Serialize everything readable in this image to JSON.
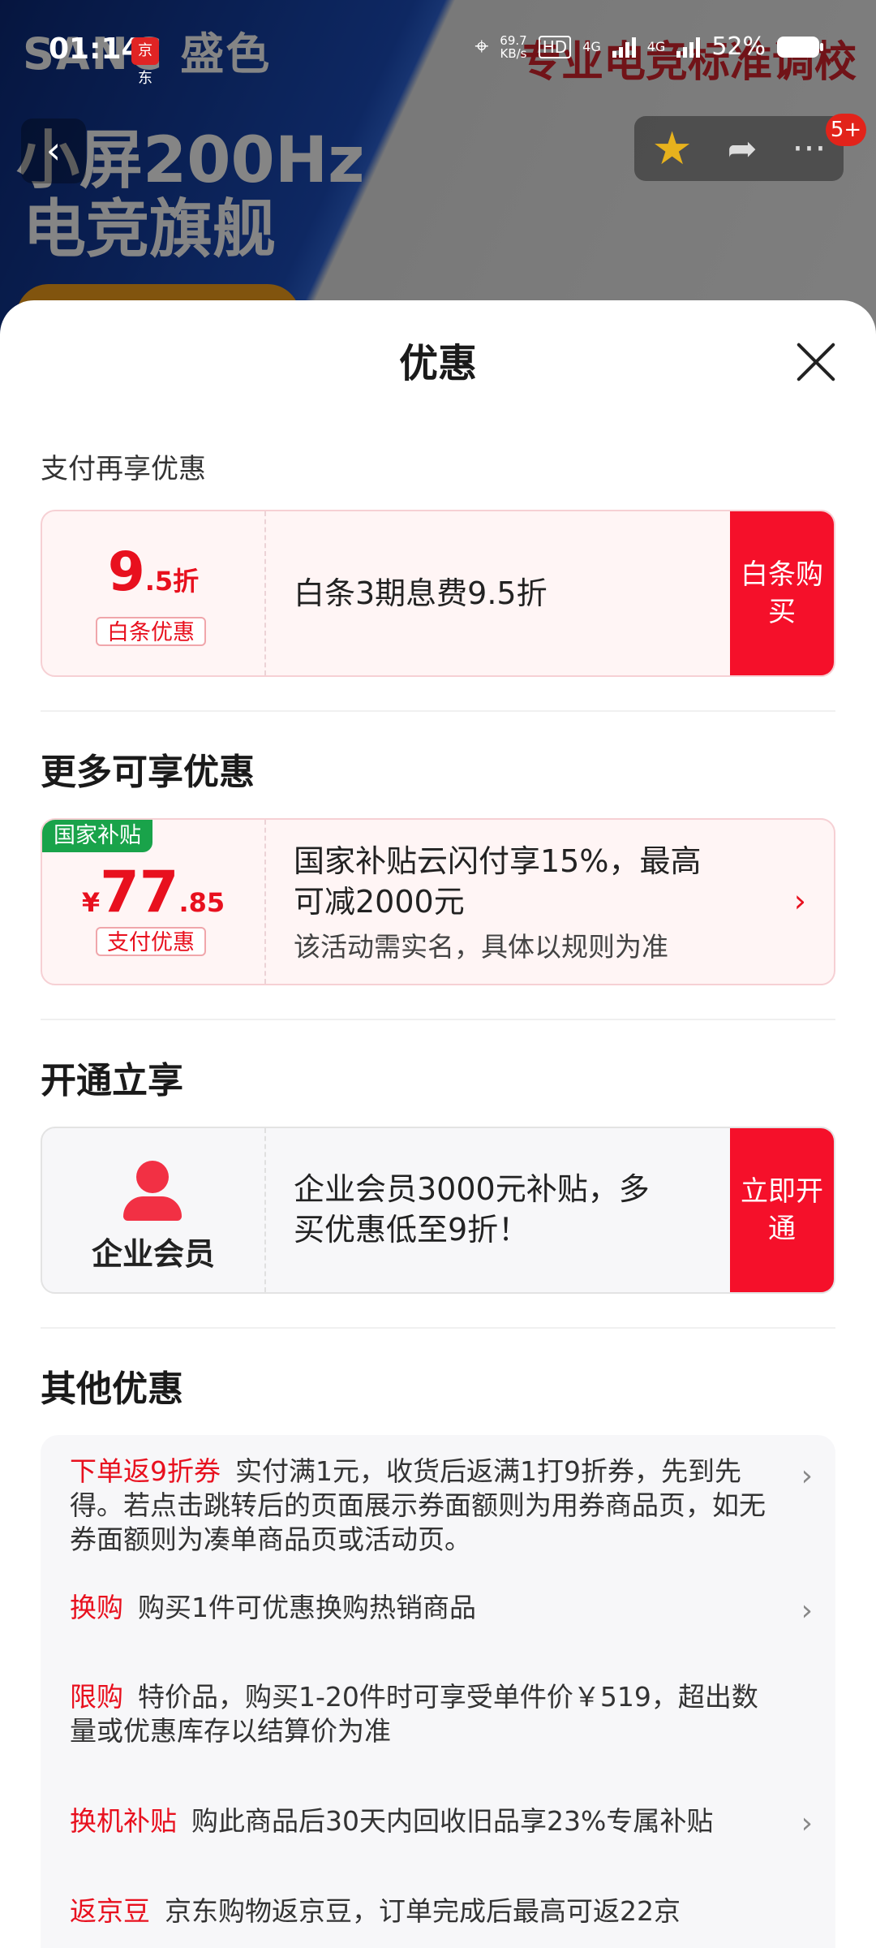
{
  "status_bar": {
    "time": "01:14",
    "app_icon_text": "京东",
    "net_speed_value": "69.7",
    "net_speed_unit": "KB/s",
    "hd": "HD",
    "sim1": "4G",
    "sim2": "4G",
    "battery": "52%"
  },
  "background": {
    "brand": "SANC 盛色",
    "slogan_line1": "小屏200Hz",
    "slogan_line2": "电竞旗舰",
    "right_text": "专业电竞标准调校",
    "cart_badge": "5+"
  },
  "sheet": {
    "title": "优惠",
    "section_payment": "支付再享优惠",
    "baitiao": {
      "discount_main": "9",
      "discount_suffix": ".5折",
      "tag": "白条优惠",
      "desc": "白条3期息费9.5折",
      "cta": "白条购买"
    },
    "section_more": "更多可享优惠",
    "gov": {
      "corner_tag": "国家补贴",
      "currency": "¥",
      "amount_main": "77",
      "amount_decimal": ".85",
      "tag": "支付优惠",
      "desc_line1": "国家补贴云闪付享15%，最高",
      "desc_line2": "可减2000元",
      "note": "该活动需实名，具体以规则为准"
    },
    "section_open": "开通立享",
    "enterprise": {
      "label": "企业会员",
      "desc_line1": "企业会员3000元补贴，多",
      "desc_line2": "买优惠低至9折！",
      "cta": "立即开通"
    },
    "section_other": "其他优惠",
    "others": [
      {
        "label": "下单返9折券",
        "text": "实付满1元，收货后返满1打9折券，先到先得。若点击跳转后的页面展示券面额则为用券商品页，如无券面额则为凑单商品页或活动页。"
      },
      {
        "label": "换购",
        "text": "购买1件可优惠换购热销商品"
      },
      {
        "label": "限购",
        "text": "特价品，购买1-20件时可享受单件价￥519，超出数量或优惠库存以结算价为准"
      },
      {
        "label": "换机补贴",
        "text": "购此商品后30天内回收旧品享23%专属补贴"
      },
      {
        "label": "返京豆",
        "text": "京东购物返京豆，订单完成后最高可返22京"
      }
    ]
  }
}
